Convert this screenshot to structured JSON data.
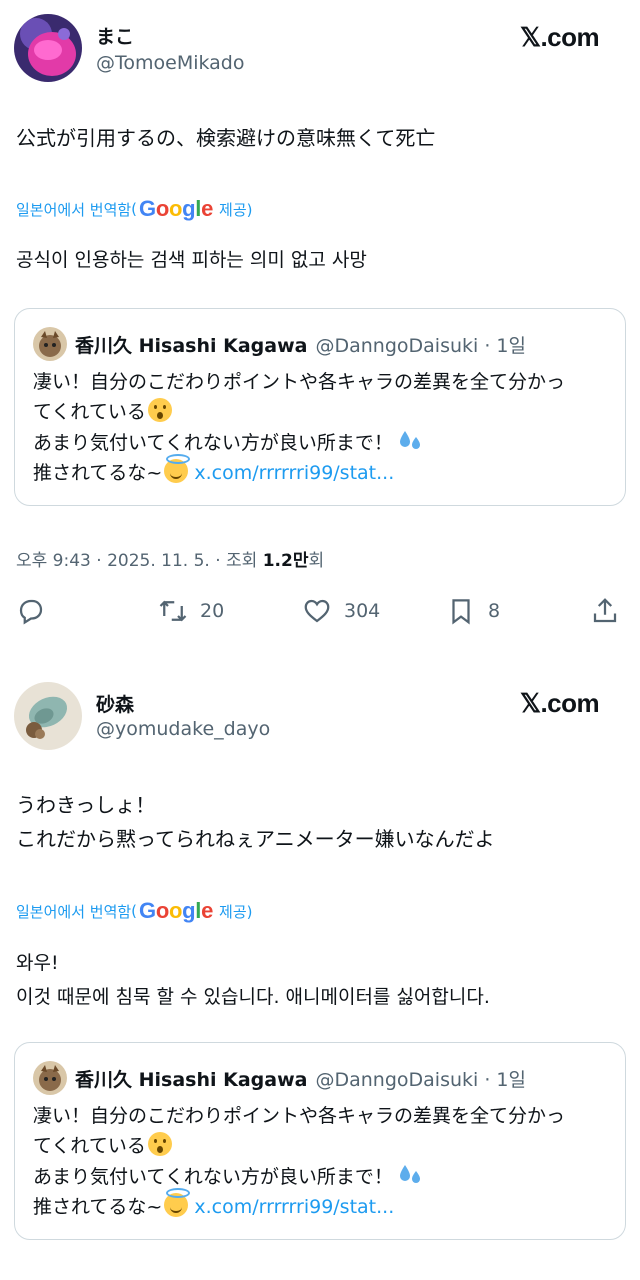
{
  "site_badge": "𝕏.com",
  "translate_prefix": "일본어에서 번역함",
  "translate_paren_open": "(",
  "translate_paren_close": "제공)",
  "google_letters": [
    "G",
    "o",
    "o",
    "g",
    "l",
    "e"
  ],
  "tweet1": {
    "name": "まこ",
    "handle": "@TomoeMikado",
    "text": "公式が引用するの、検索避けの意味無くて死亡",
    "translation": "공식이 인용하는 검색 피하는 의미 없고 사망",
    "meta_prefix": "오후 9:43 · 2025. 11. 5. · 조회 ",
    "views": "1.2만",
    "meta_suffix": "회",
    "actions": {
      "reply_count": "",
      "retweet_count": "20",
      "like_count": "304",
      "bookmark_count": "8"
    }
  },
  "tweet2": {
    "name": "砂森",
    "handle": "@yomudake_dayo",
    "text": "うわきっしょ！\nこれだから黙ってられねぇアニメーター嫌いなんだよ",
    "translation": "와우!\n이것 때문에 침묵 할 수 있습니다. 애니메이터를 싫어합니다."
  },
  "quote": {
    "name": "香川久 Hisashi Kagawa",
    "handle": "@DanngoDaisuki · 1일",
    "line1": "凄い！自分のこだわりポイントや各キャラの差異を全て分かっ",
    "line2": "てくれている",
    "line3": "あまり気付いてくれない方が良い所まで！",
    "line4_prefix": "推されてるな~",
    "link": "x.com/rrrrrri99/stat..."
  },
  "colors": {
    "link_blue": "#1d9bf0",
    "secondary_text": "#536471",
    "border": "#cfd9de"
  }
}
